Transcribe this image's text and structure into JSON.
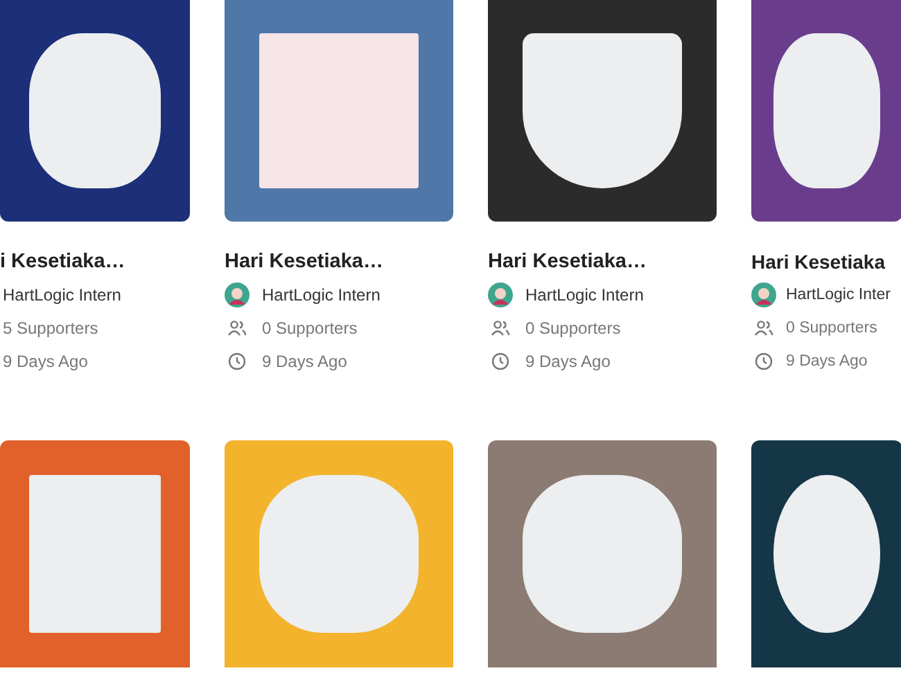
{
  "cards": [
    {
      "clipped": true,
      "title": "i Kesetiaka…",
      "author": "HartLogic Intern",
      "supporters": "5 Supporters",
      "age": "9 Days Ago"
    },
    {
      "clipped": false,
      "title": "Hari Kesetiaka…",
      "author": "HartLogic Intern",
      "supporters": "0 Supporters",
      "age": "9 Days Ago"
    },
    {
      "clipped": false,
      "title": "Hari Kesetiaka…",
      "author": "HartLogic Intern",
      "supporters": "0 Supporters",
      "age": "9 Days Ago"
    },
    {
      "clipped": false,
      "title": "Hari Kesetiaka",
      "author": "HartLogic Inter",
      "supporters": "0 Supporters",
      "age": "9 Days Ago"
    }
  ]
}
